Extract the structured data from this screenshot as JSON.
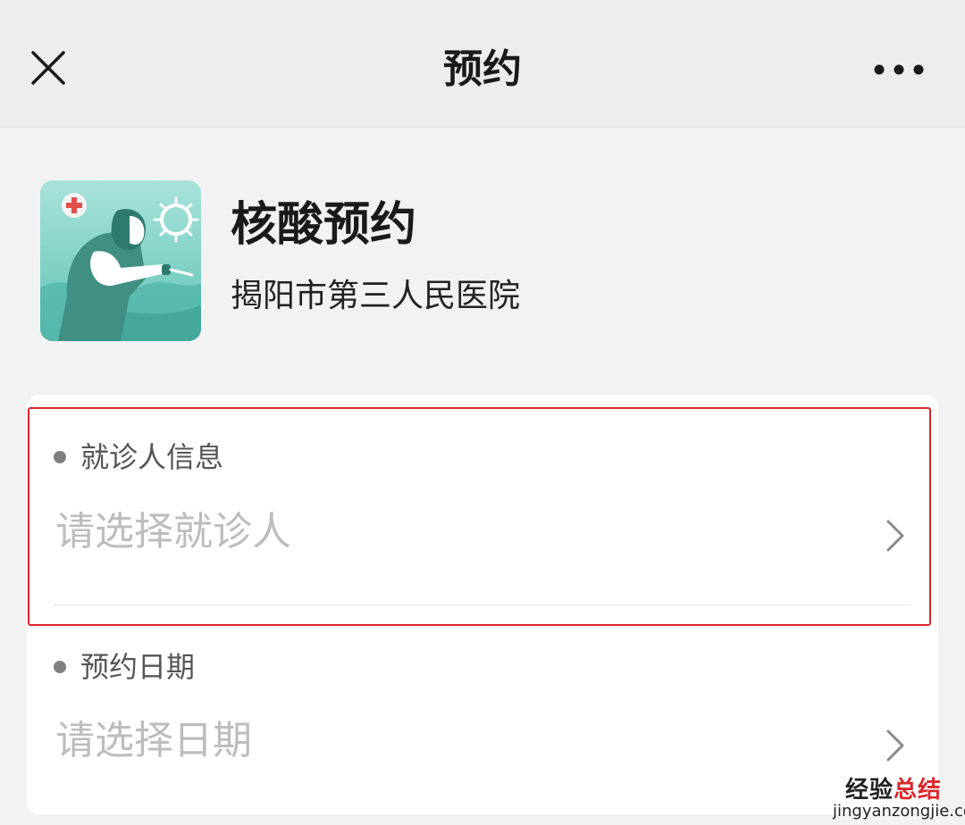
{
  "header": {
    "title": "预约",
    "close_icon": "close-icon",
    "more_icon": "more-dots-icon"
  },
  "app": {
    "name": "核酸预约",
    "org": "揭阳市第三人民医院",
    "icon": "nucleic-test-illustration-icon"
  },
  "form": {
    "patient": {
      "label": "就诊人信息",
      "placeholder": "请选择就诊人",
      "highlighted": true
    },
    "date": {
      "label": "预约日期",
      "placeholder": "请选择日期"
    }
  },
  "colors": {
    "highlight": "#d9262b",
    "placeholder": "#bdbdbd",
    "icon_bg": "#7fd1c6"
  },
  "watermark": {
    "chinese_prefix": "经验",
    "chinese_suffix": "总结",
    "url": "jingyanzongjie.com"
  }
}
